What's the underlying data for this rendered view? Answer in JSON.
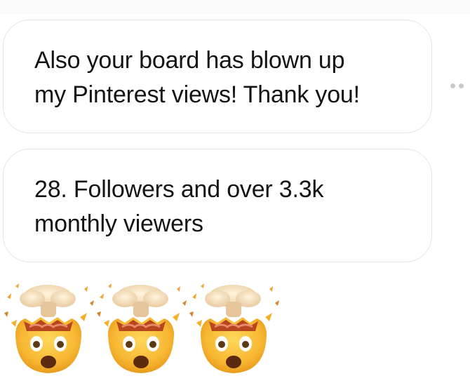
{
  "messages": [
    {
      "lines": [
        "Also your board has blown up",
        "my Pinterest views! Thank you!"
      ]
    },
    {
      "lines": [
        "28. Followers and over 3.3k",
        "monthly viewers"
      ]
    }
  ],
  "reaction": {
    "emoji_icon": "exploding-head-icon",
    "glyph": "🤯",
    "count": 3
  },
  "more_icon": "more-options-icon",
  "colors": {
    "bubble_border": "#e6e6e6",
    "text": "#141414",
    "dots": "#c8c8c8"
  }
}
